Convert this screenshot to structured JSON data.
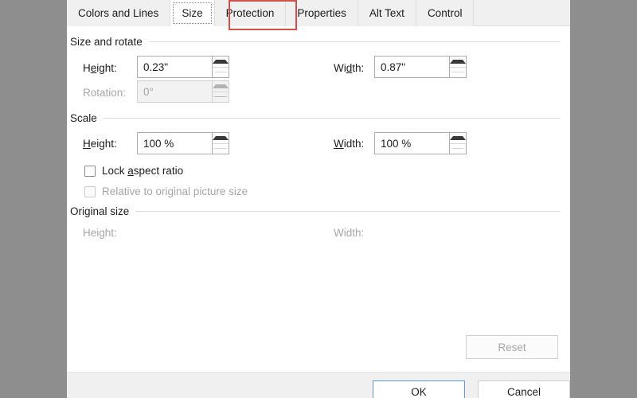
{
  "dialog": {
    "tabs": [
      {
        "label": "Colors and Lines",
        "selected": false
      },
      {
        "label": "Size",
        "selected": true
      },
      {
        "label": "Protection",
        "selected": false
      },
      {
        "label": "Properties",
        "selected": false
      },
      {
        "label": "Alt Text",
        "selected": false
      },
      {
        "label": "Control",
        "selected": false
      }
    ],
    "annotation_color": "#d0504a",
    "groups": {
      "size_and_rotate": {
        "title": "Size and rotate",
        "height_label": "Height:",
        "height_value": "0.23\"",
        "width_label": "Width:",
        "width_value": "0.87\"",
        "rotation_label": "Rotation:",
        "rotation_value": "0°"
      },
      "scale": {
        "title": "Scale",
        "height_label": "Height:",
        "height_value": "100 %",
        "width_label": "Width:",
        "width_value": "100 %",
        "lock_aspect_label": "Lock aspect ratio",
        "relative_label": "Relative to original picture size"
      },
      "original_size": {
        "title": "Original size",
        "height_label": "Height:",
        "height_value": "",
        "width_label": "Width:",
        "width_value": ""
      }
    },
    "buttons": {
      "reset": "Reset",
      "ok": "OK",
      "cancel": "Cancel"
    }
  }
}
